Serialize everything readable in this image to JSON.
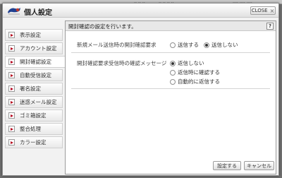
{
  "background": {
    "strip_texts": [
      "‥ ‥ ‥",
      "‥ ‥ ‥ ‥",
      "‥‥ ‥‥ ‥‥"
    ]
  },
  "titlebar": {
    "title": "個人設定",
    "close_label": "CLOSE",
    "close_icon": "×"
  },
  "sidebar": {
    "items": [
      {
        "label": "表示設定"
      },
      {
        "label": "アカウント設定"
      },
      {
        "label": "開封確認設定"
      },
      {
        "label": "自動受信設定"
      },
      {
        "label": "署名設定"
      },
      {
        "label": "迷惑メール設定"
      },
      {
        "label": "ゴミ箱設定"
      },
      {
        "label": "整合処理"
      },
      {
        "label": "カラー設定"
      }
    ],
    "active_index": 2
  },
  "panel": {
    "header": "開封確認の設定を行います。",
    "help_label": "?",
    "setting1": {
      "label": "新規メール送信時の開封確認要求",
      "options": [
        "送信する",
        "送信しない"
      ],
      "selected": 1
    },
    "setting2": {
      "label": "開封確認要求受信時の確認メッセージ",
      "options": [
        "返信しない",
        "返信時に確認する",
        "自動的に返信する"
      ],
      "selected": 0
    }
  },
  "footer": {
    "ok_label": "設定する",
    "cancel_label": "キャンセル"
  },
  "colors": {
    "accent_arrow": "#b3001b"
  }
}
